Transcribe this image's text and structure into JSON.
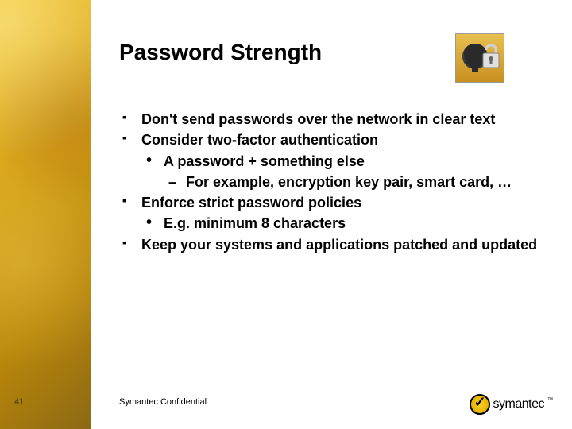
{
  "title": "Password Strength",
  "bullets": [
    {
      "level": 1,
      "text": "Don't send passwords over the network in clear text"
    },
    {
      "level": 1,
      "text": "Consider two-factor authentication"
    },
    {
      "level": 2,
      "text": "A password + something else"
    },
    {
      "level": 3,
      "text": "For example, encryption key pair, smart card, …"
    },
    {
      "level": 1,
      "text": "Enforce strict password policies"
    },
    {
      "level": 2,
      "text": "E.g. minimum 8 characters"
    },
    {
      "level": 1,
      "text": "Keep your systems and applications patched and updated"
    }
  ],
  "pageNumber": "41",
  "footer": "Symantec Confidential",
  "logo": {
    "text": "symantec",
    "tm": "™"
  },
  "icon": {
    "name": "head-padlock-icon"
  }
}
